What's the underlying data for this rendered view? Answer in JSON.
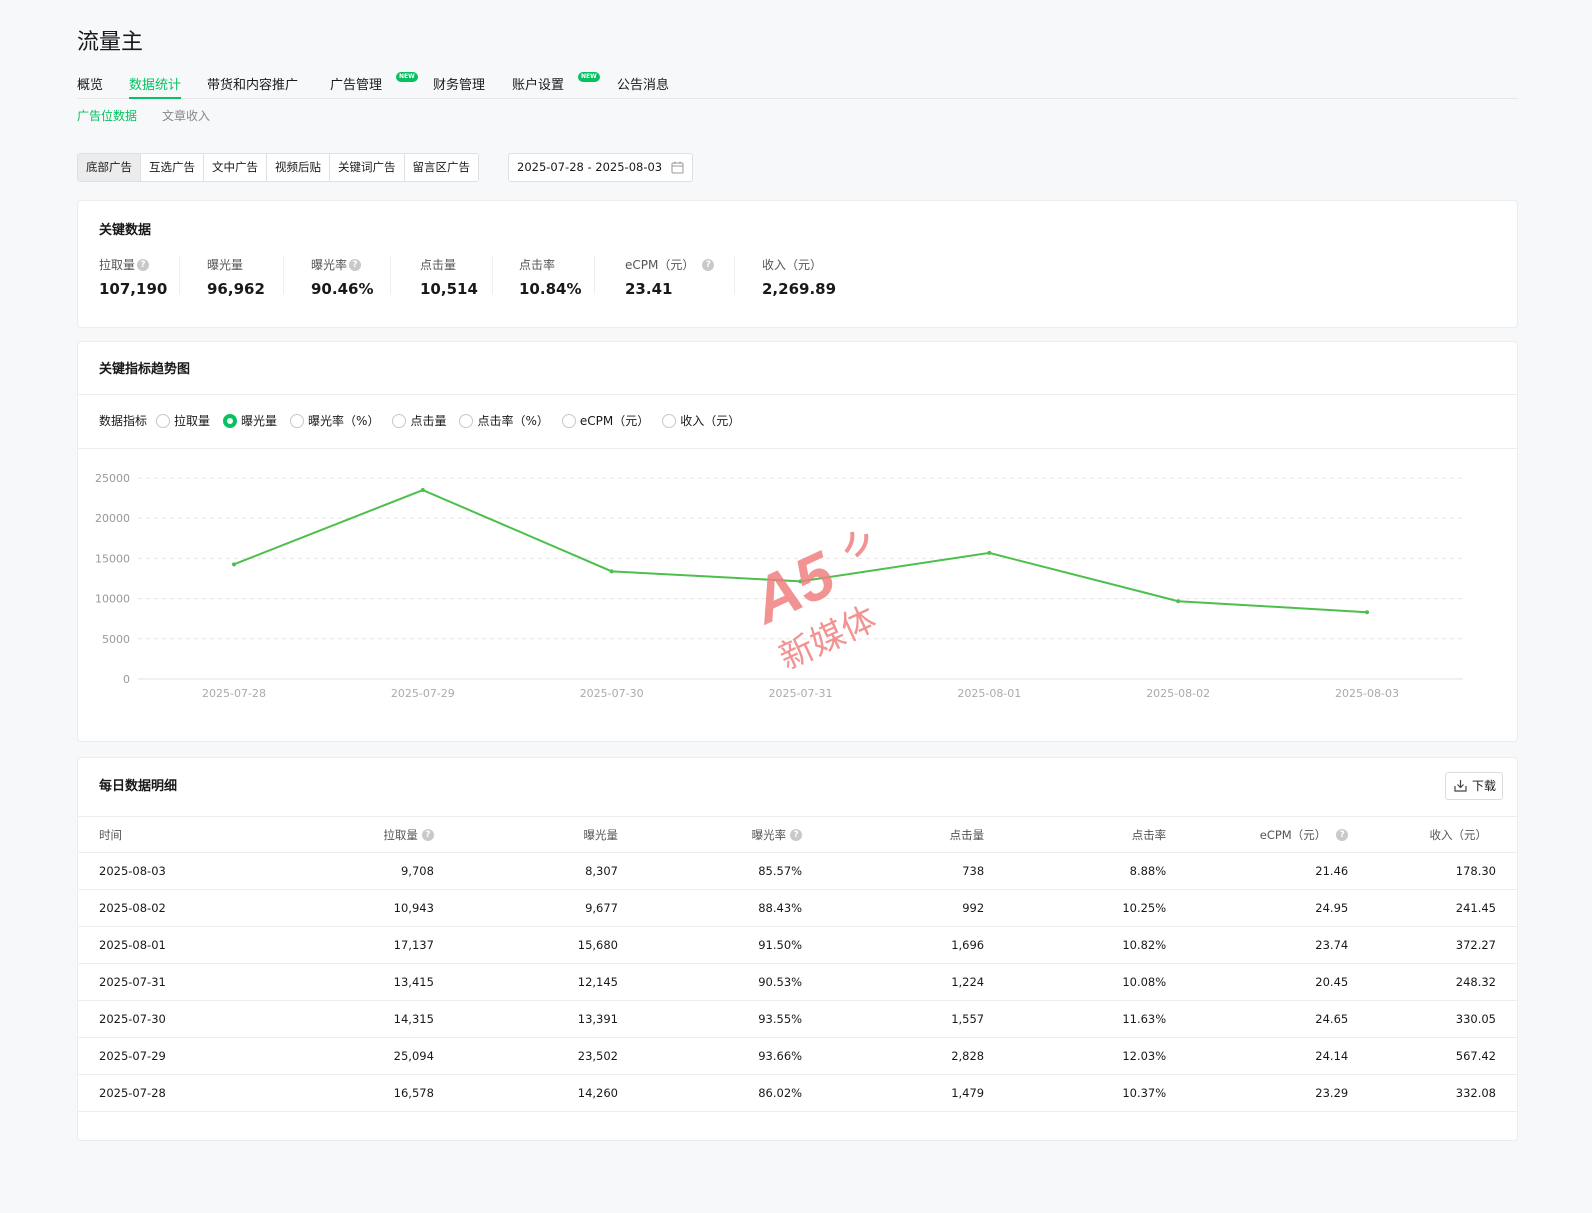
{
  "app": {
    "title": "流量主"
  },
  "main_tabs": [
    {
      "label": "概览",
      "active": false,
      "new": false
    },
    {
      "label": "数据统计",
      "active": true,
      "new": false
    },
    {
      "label": "带货和内容推广",
      "active": false,
      "new": false
    },
    {
      "label": "广告管理",
      "active": false,
      "new": true
    },
    {
      "label": "财务管理",
      "active": false,
      "new": false
    },
    {
      "label": "账户设置",
      "active": false,
      "new": true
    },
    {
      "label": "公告消息",
      "active": false,
      "new": false
    }
  ],
  "new_badge": "NEW",
  "sub_tabs": [
    {
      "label": "广告位数据",
      "active": true
    },
    {
      "label": "文章收入",
      "active": false
    }
  ],
  "ad_types": [
    {
      "label": "底部广告",
      "active": true
    },
    {
      "label": "互选广告",
      "active": false
    },
    {
      "label": "文中广告",
      "active": false
    },
    {
      "label": "视频后贴",
      "active": false
    },
    {
      "label": "关键词广告",
      "active": false
    },
    {
      "label": "留言区广告",
      "active": false
    }
  ],
  "date_range": "2025-07-28 - 2025-08-03",
  "key_data": {
    "title": "关键数据",
    "metrics": [
      {
        "label": "拉取量",
        "value": "107,190",
        "help": true
      },
      {
        "label": "曝光量",
        "value": "96,962",
        "help": false
      },
      {
        "label": "曝光率",
        "value": "90.46%",
        "help": true
      },
      {
        "label": "点击量",
        "value": "10,514",
        "help": false
      },
      {
        "label": "点击率",
        "value": "10.84%",
        "help": false
      },
      {
        "label": "eCPM（元）",
        "value": "23.41",
        "help": true
      },
      {
        "label": "收入（元）",
        "value": "2,269.89",
        "help": false
      }
    ]
  },
  "trend": {
    "title": "关键指标趋势图",
    "selector_label": "数据指标",
    "options": [
      {
        "label": "拉取量",
        "checked": false
      },
      {
        "label": "曝光量",
        "checked": true
      },
      {
        "label": "曝光率（%）",
        "checked": false
      },
      {
        "label": "点击量",
        "checked": false
      },
      {
        "label": "点击率（%）",
        "checked": false
      },
      {
        "label": "eCPM（元）",
        "checked": false
      },
      {
        "label": "收入（元）",
        "checked": false
      }
    ]
  },
  "chart_data": {
    "type": "line",
    "title": "",
    "xlabel": "",
    "ylabel": "",
    "categories": [
      "2025-07-28",
      "2025-07-29",
      "2025-07-30",
      "2025-07-31",
      "2025-08-01",
      "2025-08-02",
      "2025-08-03"
    ],
    "series": [
      {
        "values": [
          14260,
          23502,
          13391,
          12145,
          15680,
          9677,
          8307
        ],
        "color": "#4cbf4c"
      }
    ],
    "yticks": [
      0,
      5000,
      10000,
      15000,
      20000,
      25000
    ],
    "ylim": [
      0,
      25000
    ],
    "grid": true,
    "legend": "none"
  },
  "daily": {
    "title": "每日数据明细",
    "download_label": "下载",
    "columns": [
      {
        "label": "时间",
        "help": false
      },
      {
        "label": "拉取量",
        "help": true
      },
      {
        "label": "曝光量",
        "help": false
      },
      {
        "label": "曝光率",
        "help": true
      },
      {
        "label": "点击量",
        "help": false
      },
      {
        "label": "点击率",
        "help": false
      },
      {
        "label": "eCPM（元）",
        "help": true
      },
      {
        "label": "收入（元）",
        "help": false
      }
    ],
    "rows": [
      [
        "2025-08-03",
        "9,708",
        "8,307",
        "85.57%",
        "738",
        "8.88%",
        "21.46",
        "178.30"
      ],
      [
        "2025-08-02",
        "10,943",
        "9,677",
        "88.43%",
        "992",
        "10.25%",
        "24.95",
        "241.45"
      ],
      [
        "2025-08-01",
        "17,137",
        "15,680",
        "91.50%",
        "1,696",
        "10.82%",
        "23.74",
        "372.27"
      ],
      [
        "2025-07-31",
        "13,415",
        "12,145",
        "90.53%",
        "1,224",
        "10.08%",
        "20.45",
        "248.32"
      ],
      [
        "2025-07-30",
        "14,315",
        "13,391",
        "93.55%",
        "1,557",
        "11.63%",
        "24.65",
        "330.05"
      ],
      [
        "2025-07-29",
        "25,094",
        "23,502",
        "93.66%",
        "2,828",
        "12.03%",
        "24.14",
        "567.42"
      ],
      [
        "2025-07-28",
        "16,578",
        "14,260",
        "86.02%",
        "1,479",
        "10.37%",
        "23.29",
        "332.08"
      ]
    ]
  },
  "colors": {
    "accent": "#07c160",
    "line": "#4cbf4c",
    "watermark": "#f07070"
  },
  "watermark_text": "新媒体"
}
